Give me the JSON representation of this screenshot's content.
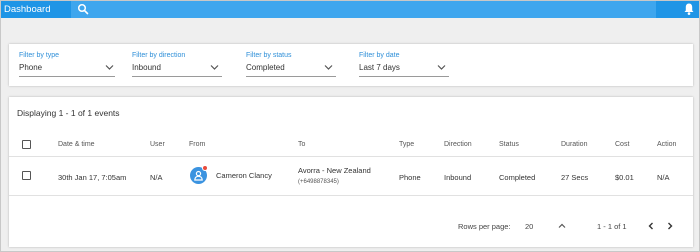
{
  "topbar": {
    "title": "Dashboard",
    "search_placeholder": "",
    "search_icon": "search-icon",
    "notification_icon": "bell-icon",
    "accent": "#1f95e6"
  },
  "filters": [
    {
      "label": "Filter by type",
      "value": "Phone"
    },
    {
      "label": "Filter by direction",
      "value": "Inbound"
    },
    {
      "label": "Filter by status",
      "value": "Completed"
    },
    {
      "label": "Filter by date",
      "value": "Last 7 days"
    }
  ],
  "events": {
    "summary": "Displaying 1 - 1 of 1 events",
    "columns": [
      "Date & time",
      "User",
      "From",
      "To",
      "Type",
      "Direction",
      "Status",
      "Duration",
      "Cost",
      "Action"
    ],
    "rows": [
      {
        "datetime": "30th Jan 17, 7:05am",
        "user": "N/A",
        "from": "Cameron Clancy",
        "to": "Avorra - New Zealand",
        "to_number": "(+6498878345)",
        "type": "Phone",
        "direction": "Inbound",
        "status": "Completed",
        "duration": "27 Secs",
        "cost": "$0.01",
        "action": "N/A"
      }
    ]
  },
  "pagination": {
    "rows_per_page_label": "Rows per page:",
    "rows_per_page": "20",
    "range": "1 - 1 of 1"
  }
}
